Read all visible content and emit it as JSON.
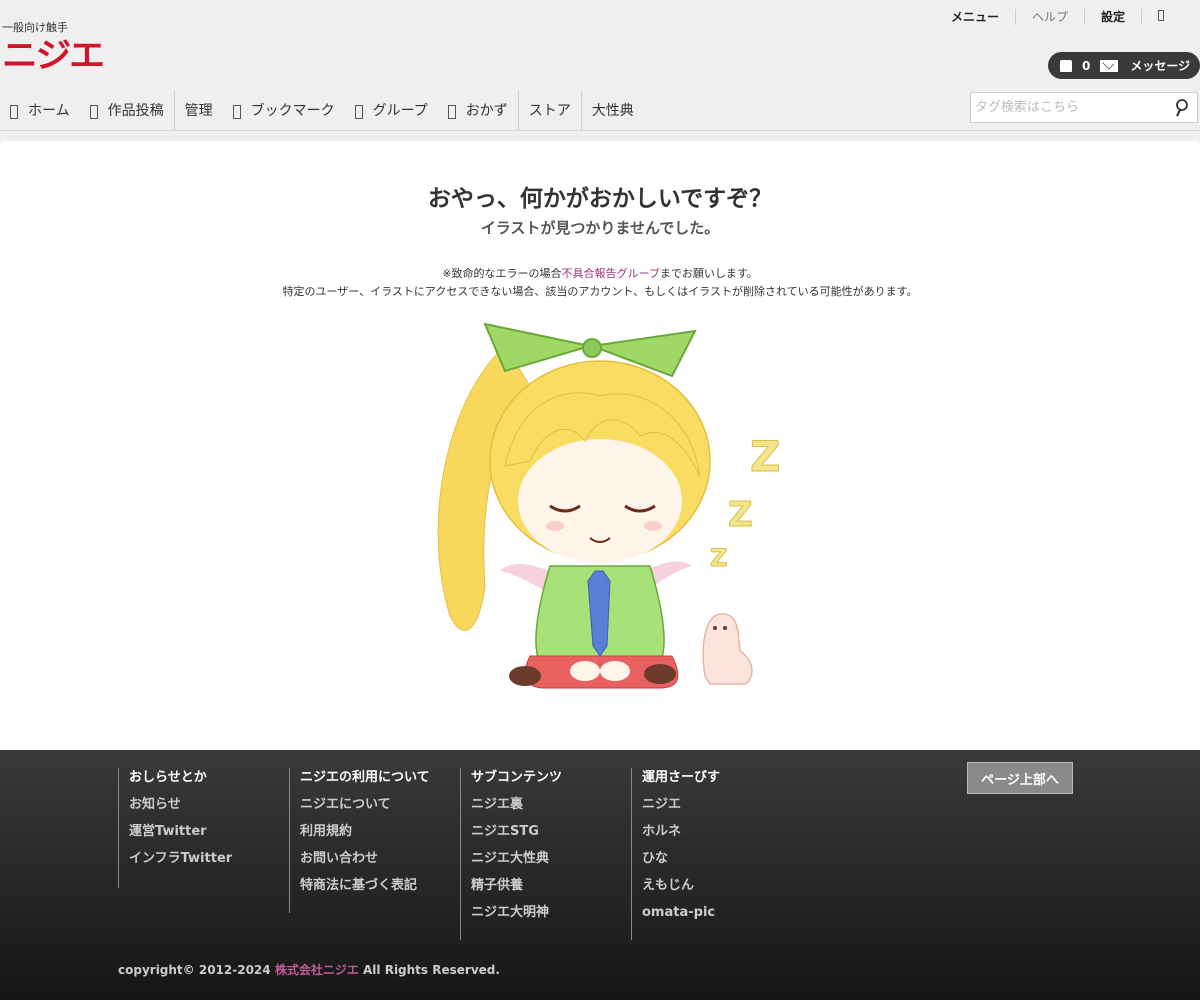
{
  "header": {
    "logo_tagline": "一般向け触手",
    "logo_text": "ニジエ",
    "topmenu": {
      "menu": "メニュー",
      "help": "ヘルプ",
      "settings": "設定"
    },
    "cart_count": "0",
    "message_label": "メッセージ"
  },
  "nav": {
    "items": [
      "ホーム",
      "作品投稿",
      "管理",
      "ブックマーク",
      "グループ",
      "おかず",
      "ストア",
      "大性典"
    ]
  },
  "search": {
    "placeholder": "タグ検索はこちら",
    "value": ""
  },
  "error": {
    "title": "おやっ、何かがおかしいですぞ？",
    "subtitle": "イラストが見つかりませんでした。",
    "note_prefix": "※致命的なエラーの場合",
    "note_link": "不具合報告グループ",
    "note_suffix": "までお願いします。",
    "note_line2": "特定のユーザー、イラストにアクセスできない場合、該当のアカウント、もしくはイラストが削除されている可能性があります。"
  },
  "footer": {
    "col1": {
      "heading": "おしらせとか",
      "links": [
        "お知らせ",
        "運営Twitter",
        "インフラTwitter"
      ]
    },
    "col2": {
      "heading": "ニジエの利用について",
      "links": [
        "ニジエについて",
        "利用規約",
        "お問い合わせ",
        "特商法に基づく表記"
      ]
    },
    "col3": {
      "heading": "サブコンテンツ",
      "links": [
        "ニジエ裏",
        "ニジエSTG",
        "ニジエ大性典",
        "精子供養",
        "ニジエ大明神"
      ]
    },
    "col4": {
      "heading": "運用さーびす",
      "links": [
        "ニジエ",
        "ホルネ",
        "ひな",
        "えもじん",
        "omata-pic"
      ]
    },
    "to_top": "ページ上部へ",
    "copy_prefix": "copyright© 2012-2024 ",
    "copy_company": "株式会社ニジエ",
    "copy_suffix": " All Rights Reserved."
  },
  "colors": {
    "brand_red": "#d0142b",
    "link_purple": "#a0347d",
    "footer_bg": "#2a2a2a"
  }
}
